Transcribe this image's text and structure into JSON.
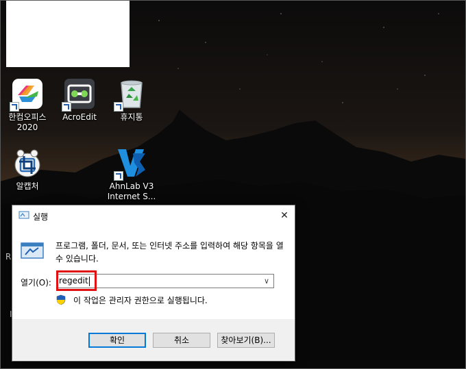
{
  "desktop": {
    "icons": [
      {
        "label": "한컴오피스\n2020",
        "icon": "hancom-office-icon"
      },
      {
        "label": "AcroEdit",
        "icon": "acroedit-icon"
      },
      {
        "label": "휴지통",
        "icon": "recycle-bin-icon"
      },
      {
        "label": "알캡처",
        "icon": "alcapture-icon"
      },
      {
        "label": "AhnLab V3\nInternet S...",
        "icon": "ahnlab-v3-icon"
      }
    ],
    "edge_glyphs": [
      "R",
      "I"
    ]
  },
  "run_dialog": {
    "title": "실행",
    "close_glyph": "✕",
    "description": "프로그램, 폴더, 문서, 또는 인터넷 주소를 입력하여 해당 항목을 열 수 있습니다.",
    "open_label": "열기(O):",
    "input_value": "regedit",
    "admin_note": "이 작업은 관리자 권한으로 실행됩니다.",
    "buttons": {
      "ok": "확인",
      "cancel": "취소",
      "browse": "찾아보기(B)..."
    },
    "highlight_color": "#e01010",
    "accent_color": "#0078d7"
  }
}
